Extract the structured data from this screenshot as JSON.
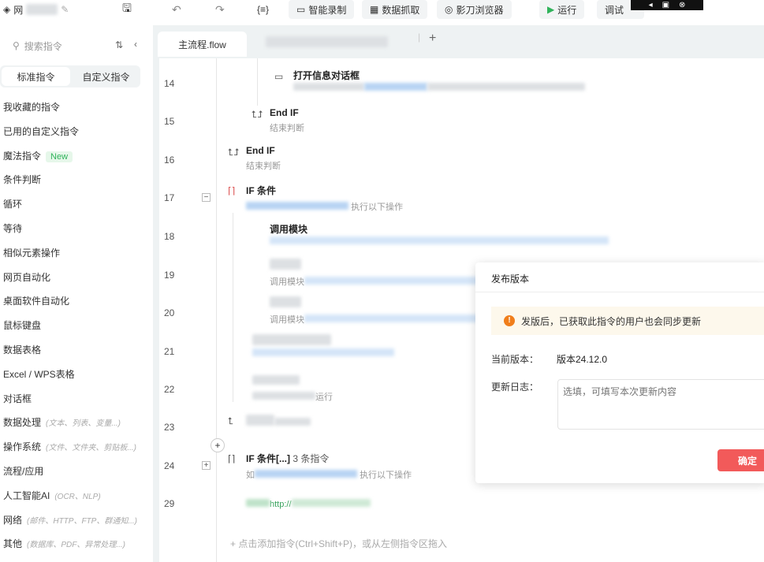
{
  "toolbar": {
    "app_title": "网",
    "items": [
      "智能录制",
      "数据抓取",
      "影刀浏览器"
    ],
    "run": "运行",
    "debug": "调试"
  },
  "sidebar": {
    "search_placeholder": "搜索指令",
    "tabs": [
      "标准指令",
      "自定义指令"
    ],
    "new_badge": "New",
    "items": [
      {
        "label": "我收藏的指令"
      },
      {
        "label": "已用的自定义指令"
      },
      {
        "label": "魔法指令"
      },
      {
        "label": "条件判断"
      },
      {
        "label": "循环"
      },
      {
        "label": "等待"
      },
      {
        "label": "相似元素操作"
      },
      {
        "label": "网页自动化"
      },
      {
        "label": "桌面软件自动化"
      },
      {
        "label": "鼠标键盘"
      },
      {
        "label": "数据表格"
      },
      {
        "label": "Excel / WPS表格"
      },
      {
        "label": "对话框"
      },
      {
        "label": "数据处理",
        "hint": "(文本、列表、变量...)"
      },
      {
        "label": "操作系统",
        "hint": "(文件、文件夹、剪贴板...)"
      },
      {
        "label": "流程/应用"
      },
      {
        "label": "人工智能AI",
        "hint": "(OCR、NLP)"
      },
      {
        "label": "网络",
        "hint": "(邮件、HTTP、FTP、群通知...)"
      },
      {
        "label": "其他",
        "hint": "(数据库、PDF、异常处理...)"
      }
    ]
  },
  "editor": {
    "tab": "主流程.flow",
    "add_tab": "+",
    "lines": [
      "14",
      "15",
      "16",
      "17",
      "18",
      "19",
      "20",
      "21",
      "22",
      "23",
      "24",
      "29"
    ],
    "row14_title": "打开信息对话框",
    "end_if": "End IF",
    "end_if_sub": "结束判断",
    "if_title": "IF 条件",
    "if_sub": "执行以下操作",
    "call_module": "调用模块",
    "call_module2": "调用模块",
    "run_suffix": "运行",
    "if_collapsed_title": "IF 条件[...]",
    "if_collapsed_count": "3 条指令",
    "if_collapsed_sub_prefix": "如",
    "if_collapsed_sub": "执行以下操作",
    "url_prefix": "http://",
    "add_hint": "点击添加指令(Ctrl+Shift+P)，或从左侧指令区拖入"
  },
  "dialog": {
    "title": "发布版本",
    "warning": "发版后，已获取此指令的用户也会同步更新",
    "current_version_label": "当前版本：",
    "current_version": "版本24.12.0",
    "log_label": "更新日志：",
    "log_placeholder": "选填，可填写本次更新内容",
    "confirm": "确定"
  }
}
